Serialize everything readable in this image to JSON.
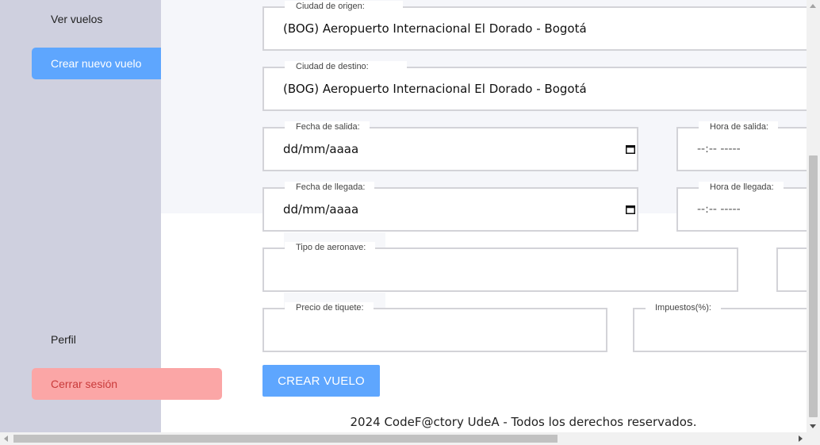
{
  "sidebar": {
    "items": [
      {
        "label": "Ver vuelos"
      },
      {
        "label": "Crear nuevo vuelo"
      },
      {
        "label": "Perfil"
      },
      {
        "label": "Cerrar sesión"
      }
    ]
  },
  "form": {
    "origin": {
      "label": "Ciudad de origen:",
      "value": "(BOG) Aeropuerto Internacional El Dorado - Bogotá"
    },
    "destination": {
      "label": "Ciudad de destino:",
      "value": "(BOG) Aeropuerto Internacional El Dorado - Bogotá"
    },
    "departure_date": {
      "label": "Fecha de salida:",
      "value": "dd/mm/aaaa"
    },
    "departure_time": {
      "label": "Hora de salida:",
      "value": "--:-- -----"
    },
    "arrival_date": {
      "label": "Fecha de llegada:",
      "value": "dd/mm/aaaa"
    },
    "arrival_time": {
      "label": "Hora de llegada:",
      "value": "--:-- -----"
    },
    "aircraft_type": {
      "label": "Tipo de aeronave:",
      "value": ""
    },
    "ticket_price": {
      "label": "Precio de tiquete:",
      "value": ""
    },
    "taxes": {
      "label": "Impuestos(%):",
      "value": ""
    },
    "submit_label": "CREAR VUELO"
  },
  "footer": {
    "text": "2024 CodeF@ctory UdeA - Todos los derechos reservados."
  },
  "colors": {
    "sidebar_bg": "#cfd0df",
    "primary": "#5ea6fe",
    "danger_bg": "#fba6a6",
    "danger_text": "#c93a3a",
    "border": "#d3d3d8"
  },
  "icons": {
    "calendar": "calendar-icon"
  }
}
